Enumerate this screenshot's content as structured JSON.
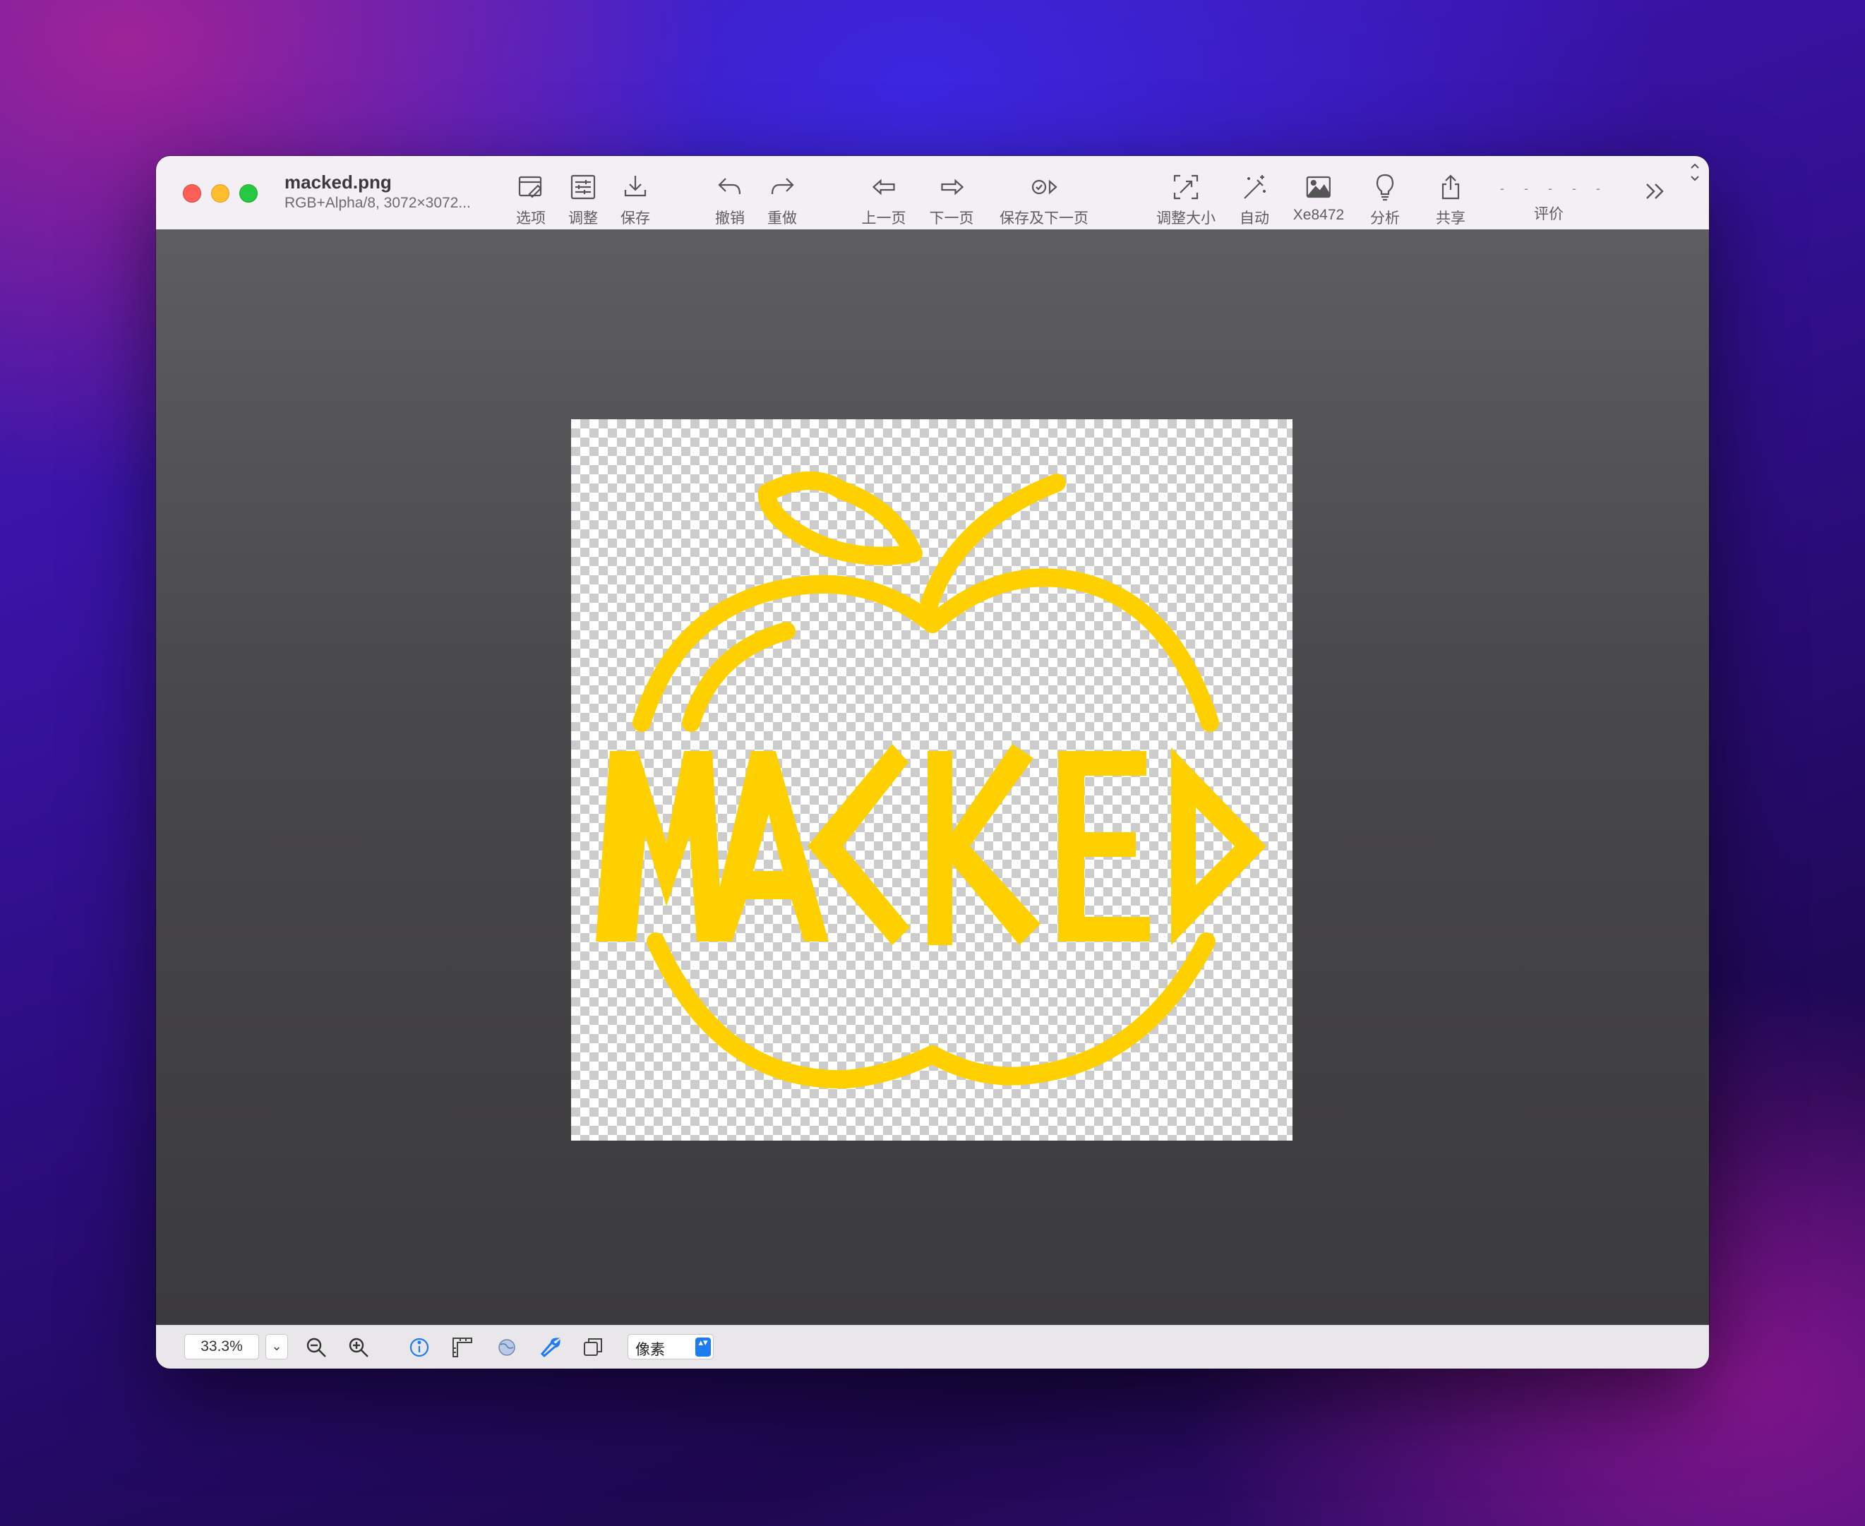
{
  "window": {
    "filename": "macked.png",
    "info": "RGB+Alpha/8, 3072×3072..."
  },
  "toolbar": {
    "options": "选项",
    "adjust": "调整",
    "save": "保存",
    "undo": "撤销",
    "redo": "重做",
    "prev_page": "上一页",
    "next_page": "下一页",
    "save_and_next": "保存及下一页",
    "resize": "调整大小",
    "auto": "自动",
    "color": "Xe8472",
    "analyze": "分析",
    "share": "共享",
    "rating": "评价",
    "rating_dots": [
      "-",
      "-",
      "-",
      "-",
      "-"
    ]
  },
  "image": {
    "logo_text": "MACKED",
    "logo_color": "#ffd000"
  },
  "statusbar": {
    "zoom": "33.3%",
    "zoom_dropdown": "⌄",
    "unit": "像素",
    "unit_arrows": "▴▾"
  },
  "colors": {
    "close": "#fe5f57",
    "minimize": "#febc2e",
    "zoom": "#28c840",
    "accent": "#1e7cf2"
  }
}
